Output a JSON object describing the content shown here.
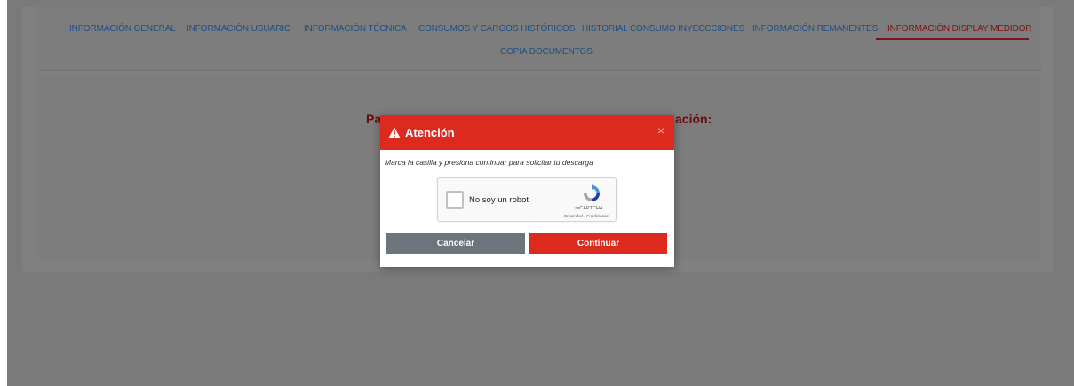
{
  "tabs": [
    {
      "label": "INFORMACIÓN GENERAL"
    },
    {
      "label": "INFORMACIÓN USUARIO"
    },
    {
      "label": "INFORMACIÓN TÉCNICA"
    },
    {
      "label": "CONSUMOS Y CARGOS HISTÓRICOS"
    },
    {
      "label": "HISTORIAL CONSUMO INYECCCIONES"
    },
    {
      "label": "INFORMACIÓN REMANENTES"
    },
    {
      "label": "INFORMACIÓN DISPLAY MEDIDOR"
    },
    {
      "label": "COPIA DOCUMENTOS"
    }
  ],
  "active_tab": "INFORMACIÓN DISPLAY MEDIDOR",
  "background": {
    "heading_left": "Pa",
    "heading_right": "ación:"
  },
  "modal": {
    "title": "Atención",
    "close": "×",
    "message": "Marca la casilla y presiona continuar para solicitar tu descarga",
    "captcha": {
      "label": "No soy un robot",
      "brand": "reCAPTCHA",
      "links": "Privacidad - Condiciones"
    },
    "cancel_label": "Cancelar",
    "continue_label": "Continuar"
  },
  "colors": {
    "accent": "#dc2a1f",
    "cancel": "#6c757d",
    "tab_link": "#1f4f86"
  }
}
